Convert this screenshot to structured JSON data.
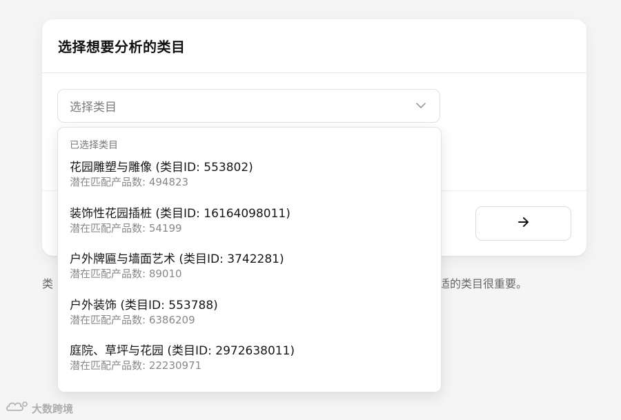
{
  "card": {
    "title": "选择想要分析的类目",
    "select_placeholder": "选择类目"
  },
  "helper": {
    "left_fragment": "类",
    "right_fragment": "合适的类目很重要。"
  },
  "dropdown": {
    "heading": "已选择类目",
    "options": [
      {
        "name": "花园雕塑与雕像 (类目ID: 553802)",
        "count": "潜在匹配产品数: 494823"
      },
      {
        "name": "装饰性花园插桩 (类目ID: 16164098011)",
        "count": "潜在匹配产品数: 54199"
      },
      {
        "name": "户外牌匾与墙面艺术 (类目ID: 3742281)",
        "count": "潜在匹配产品数: 89010"
      },
      {
        "name": "户外装饰 (类目ID: 553788)",
        "count": "潜在匹配产品数: 6386209"
      },
      {
        "name": "庭院、草坪与花园 (类目ID: 2972638011)",
        "count": "潜在匹配产品数: 22230971"
      }
    ]
  },
  "watermark": {
    "text": "大数跨境"
  },
  "icons": {
    "select_chevron": "chevron-down-icon",
    "next": "arrow-right-icon",
    "watermark_logo": "cloud-logo-icon"
  },
  "colors": {
    "background": "#f5f5f5",
    "card": "#ffffff",
    "border": "#e1e1e1",
    "muted_text": "#888888"
  }
}
